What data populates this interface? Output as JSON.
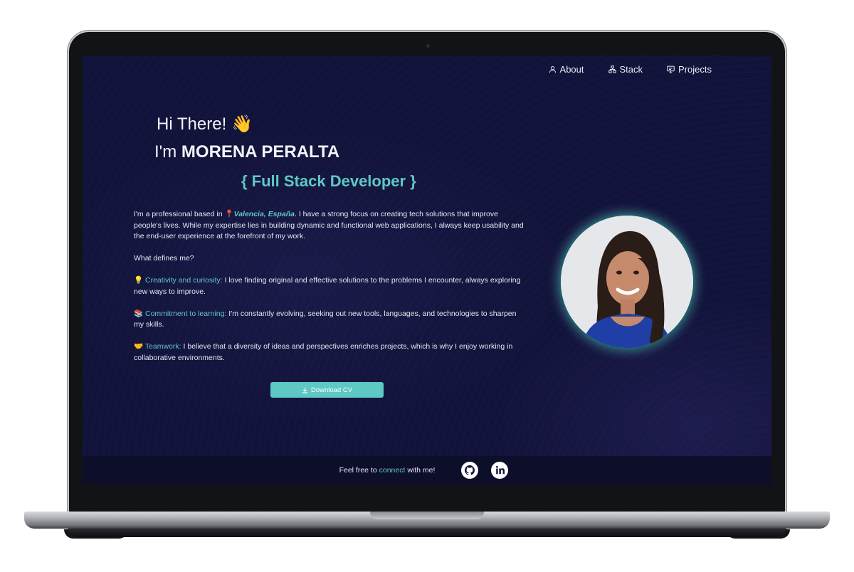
{
  "nav": {
    "about": "About",
    "stack": "Stack",
    "projects": "Projects"
  },
  "hero": {
    "greeting": "Hi There!",
    "greeting_emoji": "👋",
    "im_prefix": "I'm",
    "name": "MORENA PERALTA",
    "role": "{ Full Stack Developer }"
  },
  "bio": {
    "p1_a": "I'm a professional based in",
    "pin_emoji": "📍",
    "location": "Valencia, España",
    "p1_b": ". I have a strong focus on creating tech solutions that improve people's lives. While my expertise lies in building dynamic and functional web applications, I always keep usability and the end-user experience at the forefront of my work.",
    "question": "What defines me?",
    "items": [
      {
        "emoji": "💡",
        "title": "Creativity and curiosity:",
        "text": " I love finding original and effective solutions to the problems I encounter, always exploring new ways to improve."
      },
      {
        "emoji": "📚",
        "title": "Commitment to learning:",
        "text": " I'm constantly evolving, seeking out new tools, languages, and technologies to sharpen my skills."
      },
      {
        "emoji": "🤝",
        "title": "Teamwork:",
        "text": " I believe that a diversity of ideas and perspectives enriches projects, which is why I enjoy working in collaborative environments."
      }
    ]
  },
  "cv_button": "Download CV",
  "footer": {
    "text_a": "Feel free to",
    "link": "connect",
    "text_b": "with me!"
  },
  "icons": [
    "user-icon",
    "stack-icon",
    "projects-icon",
    "download-icon",
    "github-icon",
    "linkedin-icon"
  ],
  "colors": {
    "accent": "#5ec8c4",
    "background": "#12133a",
    "footer_bg": "#0d0e2a"
  }
}
